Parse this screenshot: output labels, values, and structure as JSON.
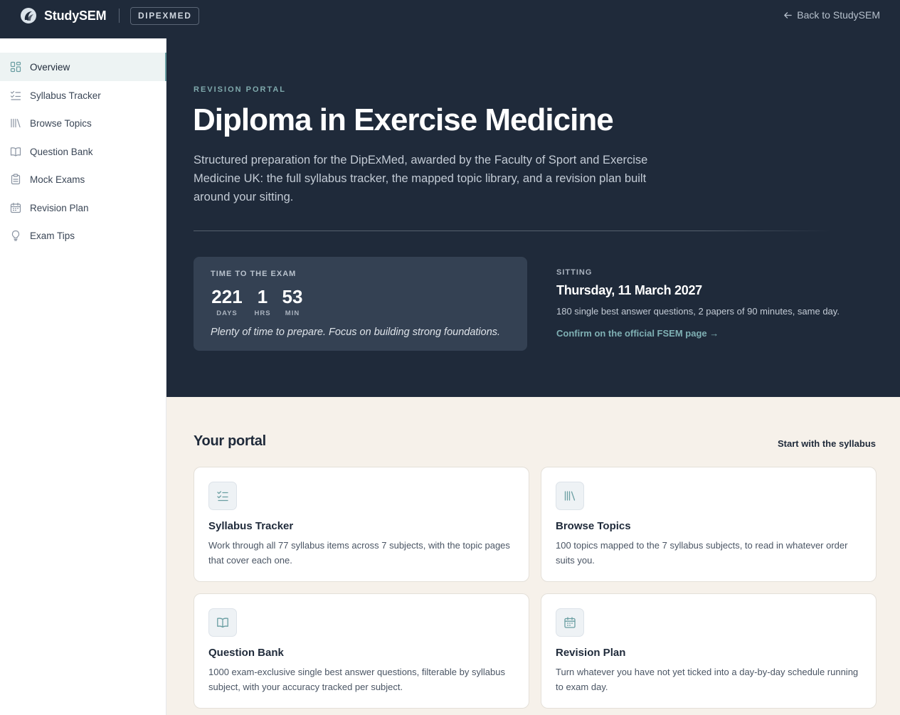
{
  "header": {
    "brand": "StudySEM",
    "badge": "DIPEXMED",
    "back_label": "Back to StudySEM",
    "back_icon": "arrow-left-icon"
  },
  "sidebar": {
    "items": [
      {
        "label": "Overview",
        "icon": "grid-icon",
        "active": true
      },
      {
        "label": "Syllabus Tracker",
        "icon": "checklist-icon",
        "active": false
      },
      {
        "label": "Browse Topics",
        "icon": "library-icon",
        "active": false
      },
      {
        "label": "Question Bank",
        "icon": "book-open-icon",
        "active": false
      },
      {
        "label": "Mock Exams",
        "icon": "clipboard-icon",
        "active": false
      },
      {
        "label": "Revision Plan",
        "icon": "calendar-icon",
        "active": false
      },
      {
        "label": "Exam Tips",
        "icon": "lightbulb-icon",
        "active": false
      }
    ]
  },
  "hero": {
    "eyebrow": "REVISION PORTAL",
    "title": "Diploma in Exercise Medicine",
    "description": "Structured preparation for the DipExMed, awarded by the Faculty of Sport and Exercise Medicine UK: the full syllabus tracker, the mapped topic library, and a revision plan built around your sitting."
  },
  "countdown": {
    "label": "TIME TO THE EXAM",
    "units": [
      {
        "value": "221",
        "unit": "DAYS"
      },
      {
        "value": "1",
        "unit": "HRS"
      },
      {
        "value": "53",
        "unit": "MIN"
      }
    ],
    "note": "Plenty of time to prepare. Focus on building strong foundations."
  },
  "sitting": {
    "label": "SITTING",
    "date": "Thursday, 11 March 2027",
    "description": "180 single best answer questions, 2 papers of 90 minutes, same day.",
    "link_label": "Confirm on the official FSEM page →"
  },
  "portal": {
    "title": "Your portal",
    "link_label": "Start with the syllabus",
    "cards": [
      {
        "title": "Syllabus Tracker",
        "icon": "checklist-icon",
        "description": "Work through all 77 syllabus items across 7 subjects, with the topic pages that cover each one."
      },
      {
        "title": "Browse Topics",
        "icon": "library-icon",
        "description": "100 topics mapped to the 7 syllabus subjects, to read in whatever order suits you."
      },
      {
        "title": "Question Bank",
        "icon": "book-open-icon",
        "description": "1000 exam-exclusive single best answer questions, filterable by syllabus subject, with your accuracy tracked per subject."
      },
      {
        "title": "Revision Plan",
        "icon": "calendar-icon",
        "description": "Turn whatever you have not yet ticked into a day-by-day schedule running to exam day."
      }
    ]
  },
  "colors": {
    "navy": "#1f2a3a",
    "accent_teal": "#7fa9ac",
    "cream": "#f6f1ea",
    "card_dark": "#344153"
  }
}
